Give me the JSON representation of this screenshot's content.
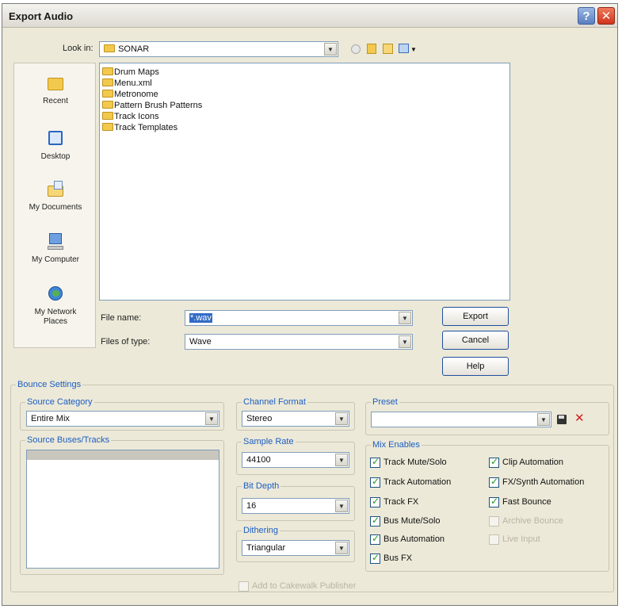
{
  "dialog": {
    "title": "Export Audio",
    "help_glyph": "?",
    "close_glyph": "✕"
  },
  "look_in": {
    "label": "Look in:",
    "value": "SONAR"
  },
  "places": [
    {
      "label": "Recent",
      "icon": "recent-folder-icon"
    },
    {
      "label": "Desktop",
      "icon": "desktop-icon"
    },
    {
      "label": "My Documents",
      "icon": "my-documents-icon"
    },
    {
      "label": "My Computer",
      "icon": "my-computer-icon"
    },
    {
      "label": "My Network Places",
      "icon": "network-places-icon"
    }
  ],
  "files": [
    "Drum Maps",
    "Menu.xml",
    "Metronome",
    "Pattern Brush Patterns",
    "Track Icons",
    "Track Templates"
  ],
  "file_name": {
    "label": "File name:",
    "value": "*.wav"
  },
  "files_of_type": {
    "label": "Files of type:",
    "value": "Wave"
  },
  "buttons": {
    "export": "Export",
    "cancel": "Cancel",
    "help": "Help"
  },
  "bounce": {
    "title": "Bounce Settings",
    "source_category": {
      "title": "Source Category",
      "value": "Entire Mix"
    },
    "source_buses": {
      "title": "Source Buses/Tracks"
    },
    "channel_format": {
      "title": "Channel Format",
      "value": "Stereo"
    },
    "sample_rate": {
      "title": "Sample Rate",
      "value": "44100"
    },
    "bit_depth": {
      "title": "Bit Depth",
      "value": "16"
    },
    "dithering": {
      "title": "Dithering",
      "value": "Triangular"
    },
    "preset": {
      "title": "Preset",
      "value": ""
    },
    "mix_enables": {
      "title": "Mix Enables",
      "left": [
        {
          "label": "Track Mute/Solo",
          "checked": true
        },
        {
          "label": "Track Automation",
          "checked": true
        },
        {
          "label": "Track FX",
          "checked": true
        },
        {
          "label": "Bus Mute/Solo",
          "checked": true
        },
        {
          "label": "Bus Automation",
          "checked": true
        },
        {
          "label": "Bus FX",
          "checked": true
        }
      ],
      "right": [
        {
          "label": "Clip Automation",
          "checked": true,
          "enabled": true
        },
        {
          "label": "FX/Synth Automation",
          "checked": true,
          "enabled": true
        },
        {
          "label": "Fast Bounce",
          "checked": true,
          "enabled": true
        },
        {
          "label": "Archive Bounce",
          "checked": false,
          "enabled": false
        },
        {
          "label": "Live Input",
          "checked": false,
          "enabled": false
        }
      ]
    },
    "add_publisher": {
      "label": "Add to Cakewalk Publisher",
      "checked": false,
      "enabled": false
    }
  },
  "colors": {
    "accent": "#1b5dc2",
    "dialog_bg": "#ece9d8",
    "checkmark": "#1c9a1c",
    "delete_x": "#d22020"
  }
}
